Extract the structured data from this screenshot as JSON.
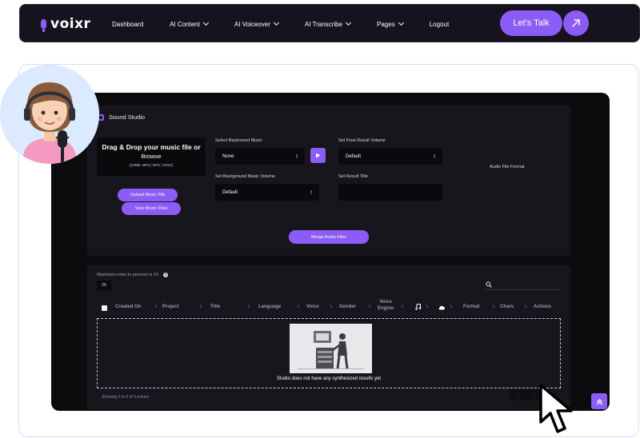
{
  "nav": {
    "logo": "voixr",
    "items": [
      "Dashboard",
      "AI Content",
      "AI Voiceover",
      "AI Transcribe",
      "Pages",
      "Logout"
    ],
    "cta": "Let's Talk"
  },
  "studio": {
    "title": "Sound Studio",
    "dropzone_main": "Drag & Drop your music file or",
    "dropzone_browse": "Browse",
    "dropzone_formats": "[10MB: MP3 | WAV | OGG]",
    "upload_button": "Upload Music File",
    "view_button": "View Music Files",
    "bg_music_label": "Select Backround Music",
    "bg_music_value": "None",
    "bg_volume_label": "Set Background Music Volume",
    "bg_volume_value": "Default",
    "final_volume_label": "Set Final Result Volume",
    "final_volume_value": "Default",
    "result_title_label": "Set Result Title",
    "format_label": "Audio File Format",
    "merge_button": "Merge Audio Files"
  },
  "table": {
    "max_rows_note": "Maximum rows to process is 10",
    "page_size": "25",
    "columns": [
      "Created On",
      "Project",
      "Title",
      "Language",
      "Voice",
      "Gender",
      "Voice Engine",
      "Format",
      "Chars",
      "Actions"
    ],
    "empty_message": "Studio does not have any synthesized results yet",
    "showing": "Showing 0 to 0 of 0 entries"
  },
  "colors": {
    "accent": "#8b5cf6",
    "app_bg": "#0c0c0f",
    "panel_bg": "#17161c",
    "nav_bg": "#16131f"
  }
}
